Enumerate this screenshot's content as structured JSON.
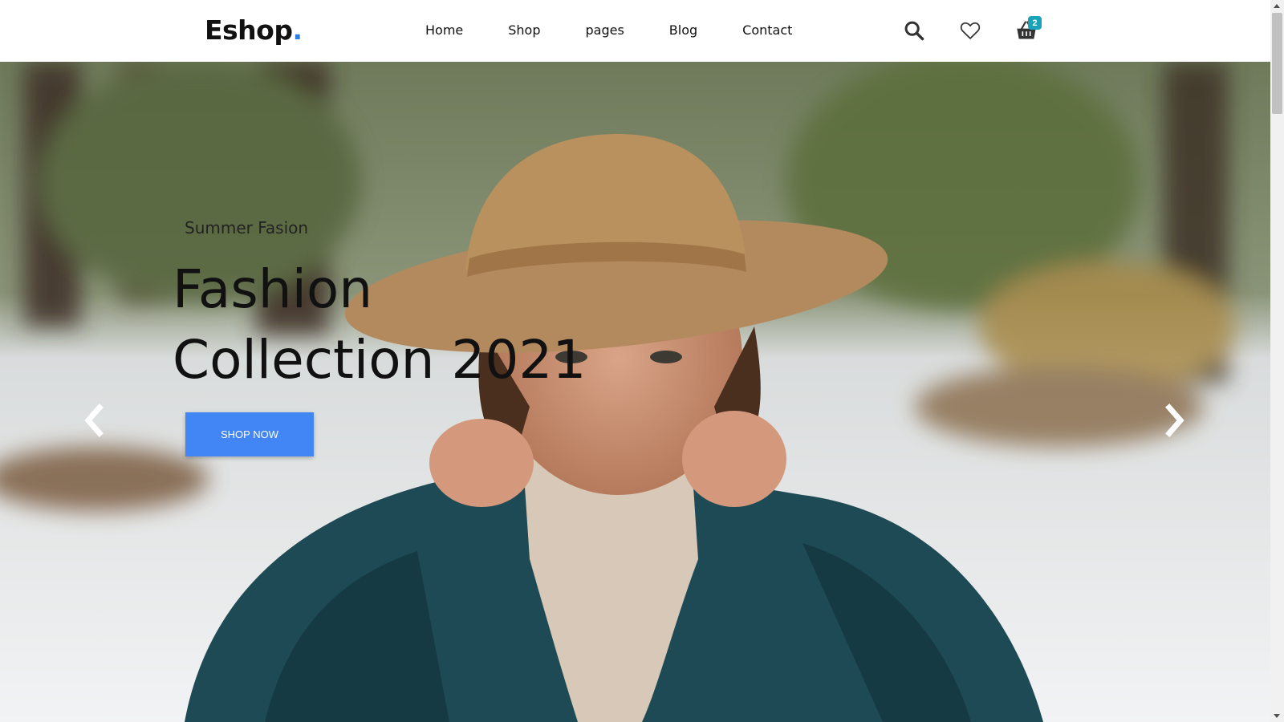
{
  "brand": {
    "name": "Eshop",
    "dot": "."
  },
  "nav": {
    "items": [
      {
        "label": "Home"
      },
      {
        "label": "Shop"
      },
      {
        "label": "pages"
      },
      {
        "label": "Blog"
      },
      {
        "label": "Contact"
      }
    ]
  },
  "header_icons": {
    "search": "search-icon",
    "wishlist": "heart-icon",
    "cart": "basket-icon",
    "cart_count": "2"
  },
  "hero": {
    "subtitle": "Summer Fasion",
    "title_line1": "Fashion",
    "title_line2": "Collection 2021",
    "button_label": "SHOP NOW",
    "prev_icon": "chevron-left-icon",
    "next_icon": "chevron-right-icon"
  },
  "colors": {
    "accent": "#4285f4",
    "logo_dot": "#2f7de1",
    "badge": "#1aa3b8"
  }
}
